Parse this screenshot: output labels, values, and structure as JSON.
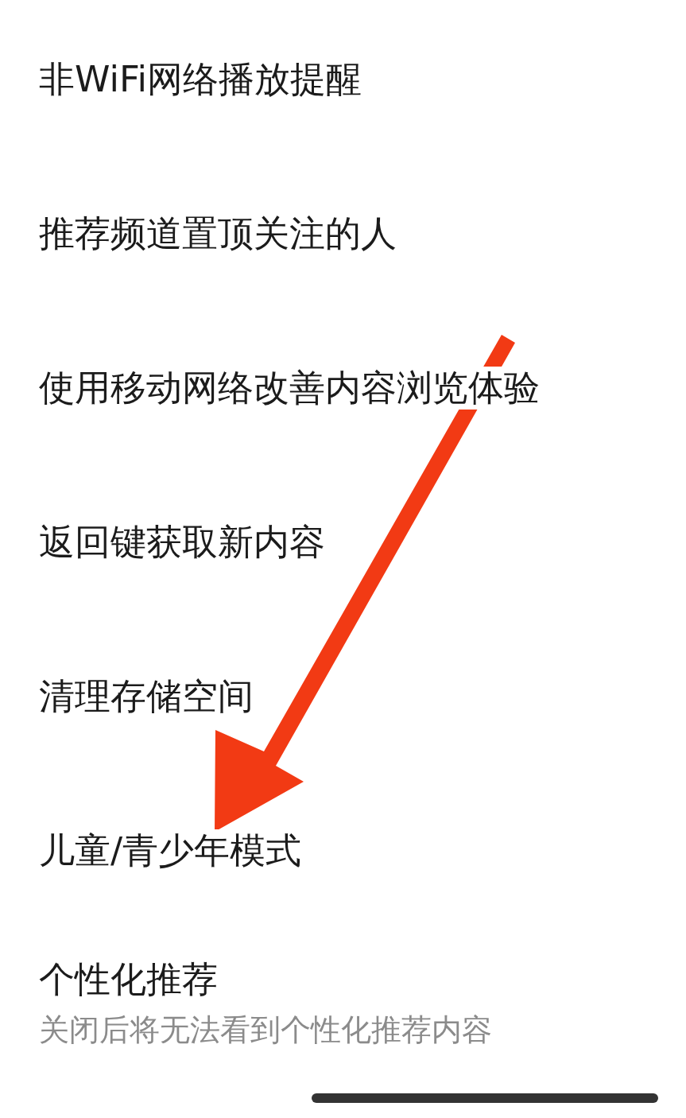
{
  "settings": [
    {
      "title": "非WiFi网络播放提醒"
    },
    {
      "title": "推荐频道置顶关注的人"
    },
    {
      "title": "使用移动网络改善内容浏览体验"
    },
    {
      "title": "返回键获取新内容"
    },
    {
      "title": "清理存储空间"
    },
    {
      "title": "儿童/青少年模式"
    },
    {
      "title": "个性化推荐",
      "description": "关闭后将无法看到个性化推荐内容"
    }
  ]
}
